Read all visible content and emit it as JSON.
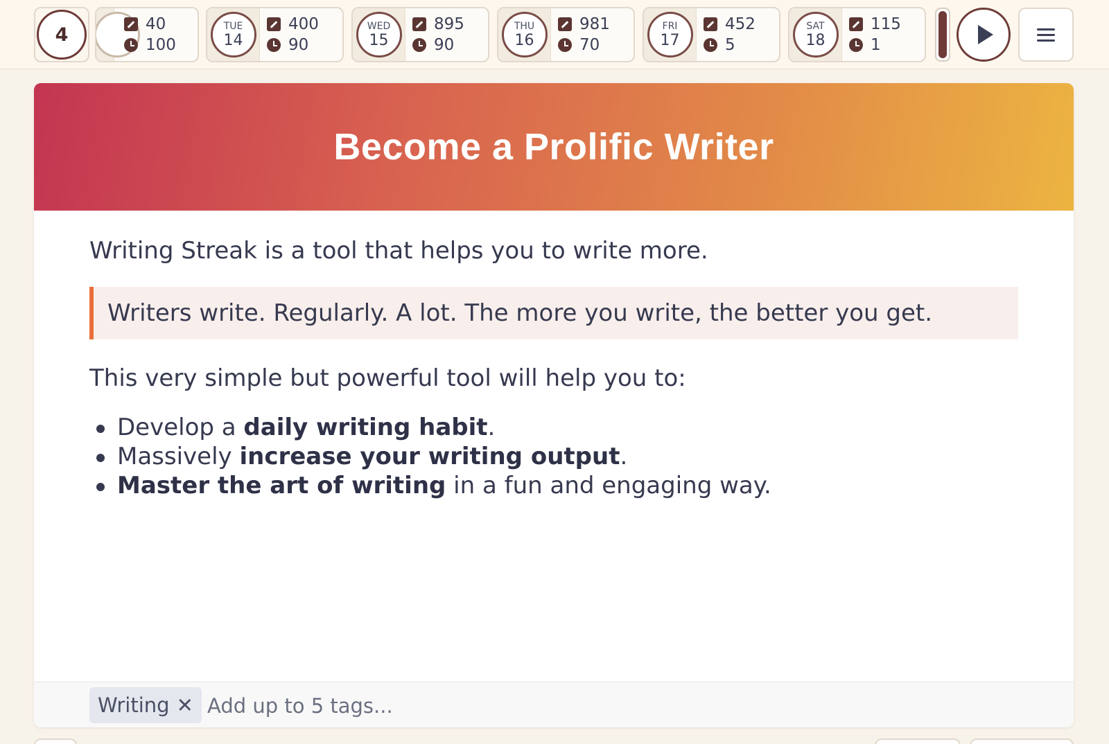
{
  "streak": {
    "count": "4"
  },
  "days": [
    {
      "name": "",
      "date": "",
      "words": "40",
      "minutes": "100",
      "partial": true
    },
    {
      "name": "TUE",
      "date": "14",
      "words": "400",
      "minutes": "90"
    },
    {
      "name": "WED",
      "date": "15",
      "words": "895",
      "minutes": "90"
    },
    {
      "name": "THU",
      "date": "16",
      "words": "981",
      "minutes": "70"
    },
    {
      "name": "FRI",
      "date": "17",
      "words": "452",
      "minutes": "5"
    },
    {
      "name": "SAT",
      "date": "18",
      "words": "115",
      "minutes": "1"
    }
  ],
  "icons": {
    "words": "pencil-icon",
    "minutes": "clock-icon",
    "play": "play-icon",
    "menu": "hamburger-menu-icon"
  },
  "card": {
    "title": "Become a Prolific Writer",
    "intro": "Writing Streak is a tool that helps you to write more.",
    "quote": "Writers write. Regularly. A lot. The more you write, the better you get.",
    "lead": "This very simple but powerful tool will help you to:",
    "bullets": [
      {
        "pre": "Develop a ",
        "bold": "daily writing habit",
        "post": "."
      },
      {
        "pre": "Massively ",
        "bold": "increase your writing output",
        "post": "."
      },
      {
        "pre": "",
        "bold": "Master the art of writing",
        "post": " in a fun and engaging way."
      }
    ]
  },
  "tags": {
    "items": [
      "Writing"
    ],
    "remove_glyph": "✕",
    "placeholder": "Add up to 5 tags..."
  },
  "colors": {
    "accent": "#6e3b37",
    "quote_bar": "#e9703a",
    "banner_start": "#c33551",
    "banner_end": "#ecb441"
  }
}
